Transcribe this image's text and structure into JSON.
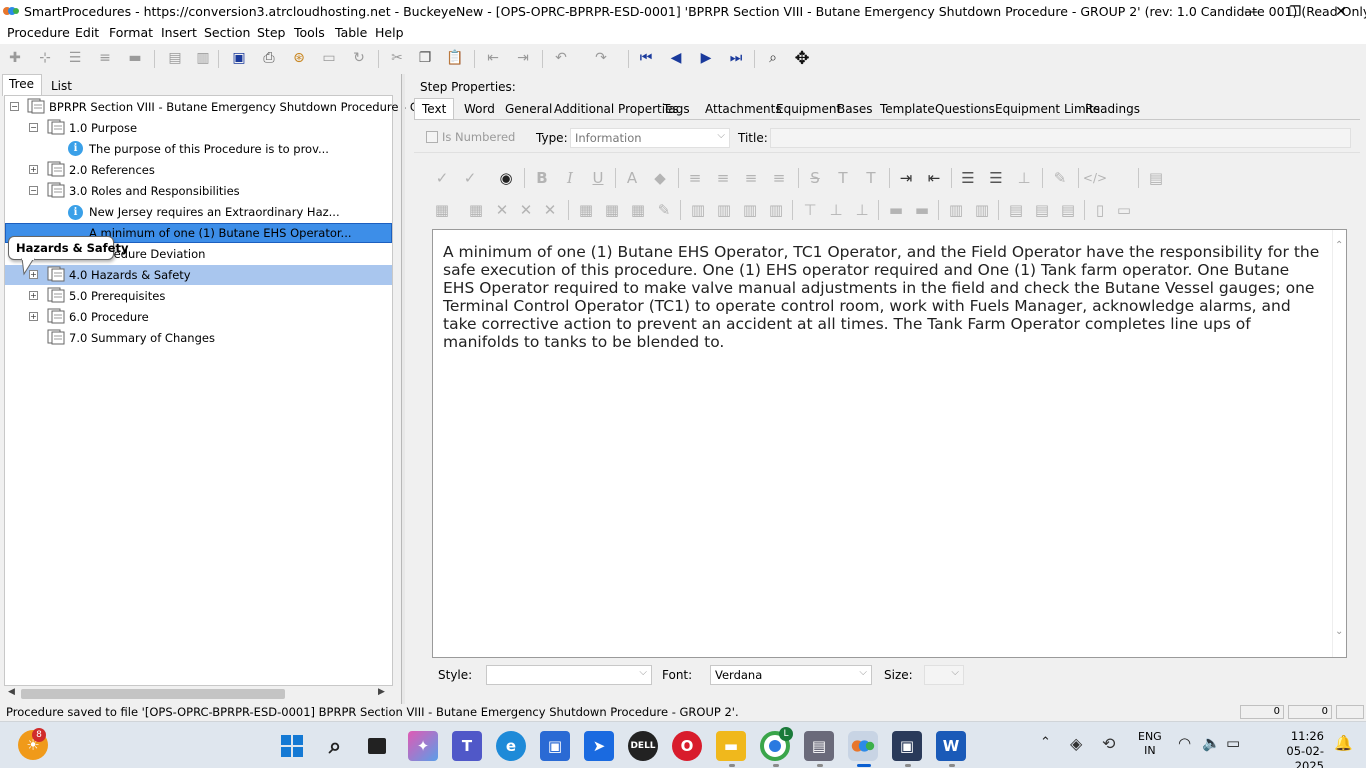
{
  "window": {
    "title": "SmartProcedures - https://conversion3.atrcloudhosting.net - BuckeyeNew - [OPS-OPRC-BPRPR-ESD-0001] 'BPRPR Section VIII - Butane Emergency Shutdown Procedure - GROUP 2' (rev: 1.0 Candidate 001) (Read Only)",
    "minimize": "—",
    "maximize": "❐",
    "close": "✕"
  },
  "menu": [
    "Procedure",
    "Edit",
    "Format",
    "Insert",
    "Section",
    "Step",
    "Tools",
    "Table",
    "Help"
  ],
  "left_tabs": [
    "Tree",
    "List"
  ],
  "tree": [
    {
      "label": "BPRPR Section VIII - Butane Emergency Shutdown Procedure - G..."
    },
    {
      "label": "1.0 Purpose"
    },
    {
      "label": "The purpose of this Procedure is to prov..."
    },
    {
      "label": "2.0 References"
    },
    {
      "label": "3.0 Roles and Responsibilities"
    },
    {
      "label": "New Jersey requires an Extraordinary Haz..."
    },
    {
      "label": "A minimum of one (1) Butane EHS Operator..."
    },
    {
      "label": "Procedure Deviation"
    },
    {
      "label": "4.0 Hazards & Safety"
    },
    {
      "label": "5.0 Prerequisites"
    },
    {
      "label": "6.0 Procedure"
    },
    {
      "label": "7.0 Summary of Changes"
    }
  ],
  "tooltip": "Hazards & Safety",
  "step_properties": {
    "heading": "Step Properties:",
    "tabs": [
      "Text",
      "Word",
      "General",
      "Additional Properties",
      "Tags",
      "Attachments",
      "Equipment",
      "Bases",
      "Template",
      "Questions",
      "Equipment Limits",
      "Readings"
    ],
    "is_numbered_label": "Is Numbered",
    "type_label": "Type:",
    "type_value": "Information",
    "title_label": "Title:",
    "title_value": ""
  },
  "editor_text": "A minimum of one (1) Butane EHS Operator, TC1 Operator, and the Field Operator have the responsibility for the safe execution of this procedure. One (1) EHS operator required and One (1) Tank farm operator. One Butane EHS Operator required to make valve manual adjustments in the field and check the Butane Vessel gauges; one Terminal Control Operator (TC1) to operate control room, work with Fuels Manager, acknowledge alarms, and take corrective action to prevent an accident at all times. The Tank Farm Operator completes line ups of manifolds to tanks to be blended to.",
  "bottom": {
    "style_label": "Style:",
    "style_value": "",
    "font_label": "Font:",
    "font_value": "Verdana",
    "size_label": "Size:",
    "size_value": ""
  },
  "status_text": "Procedure saved to file '[OPS-OPRC-BPRPR-ESD-0001] BPRPR Section VIII - Butane Emergency Shutdown Procedure - GROUP 2'.",
  "status_fields": [
    "0",
    "0"
  ],
  "taskbar": {
    "notification_count": "8",
    "lang_line1": "ENG",
    "lang_line2": "IN",
    "time": "11:26",
    "date": "05-02-2025",
    "dell_label": "DELL",
    "chrome_badge": "L"
  },
  "colors": {
    "selected_row": "#3d8ee8",
    "hover_row": "#a9c6ee",
    "accent": "#0a5fd1"
  }
}
